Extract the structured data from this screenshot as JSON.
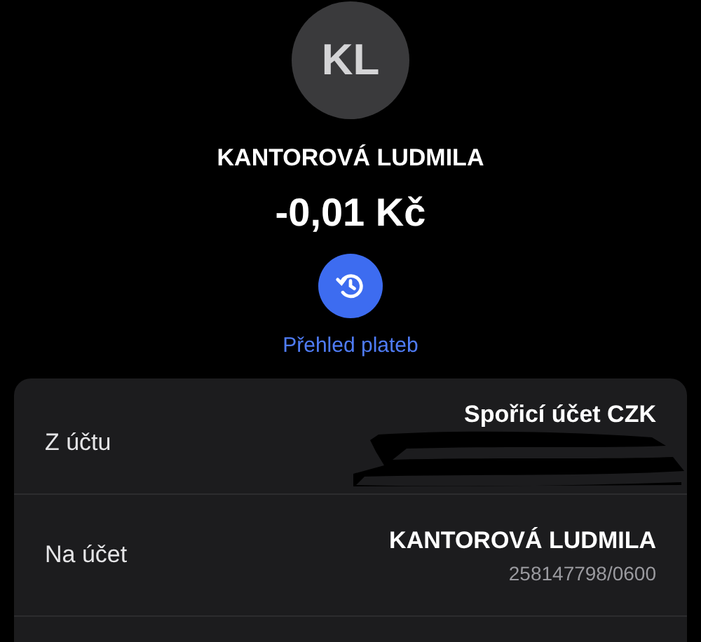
{
  "avatar": {
    "initials": "KL"
  },
  "name": "KANTOROVÁ LUDMILA",
  "amount": "-0,01 Kč",
  "history": {
    "label": "Přehled plateb"
  },
  "details": [
    {
      "label": "Z účtu",
      "value": "Spořicí účet CZK",
      "redacted": true
    },
    {
      "label": "Na účet",
      "value": "KANTOROVÁ LUDMILA",
      "sub": "258147798/0600",
      "redacted": false
    }
  ]
}
